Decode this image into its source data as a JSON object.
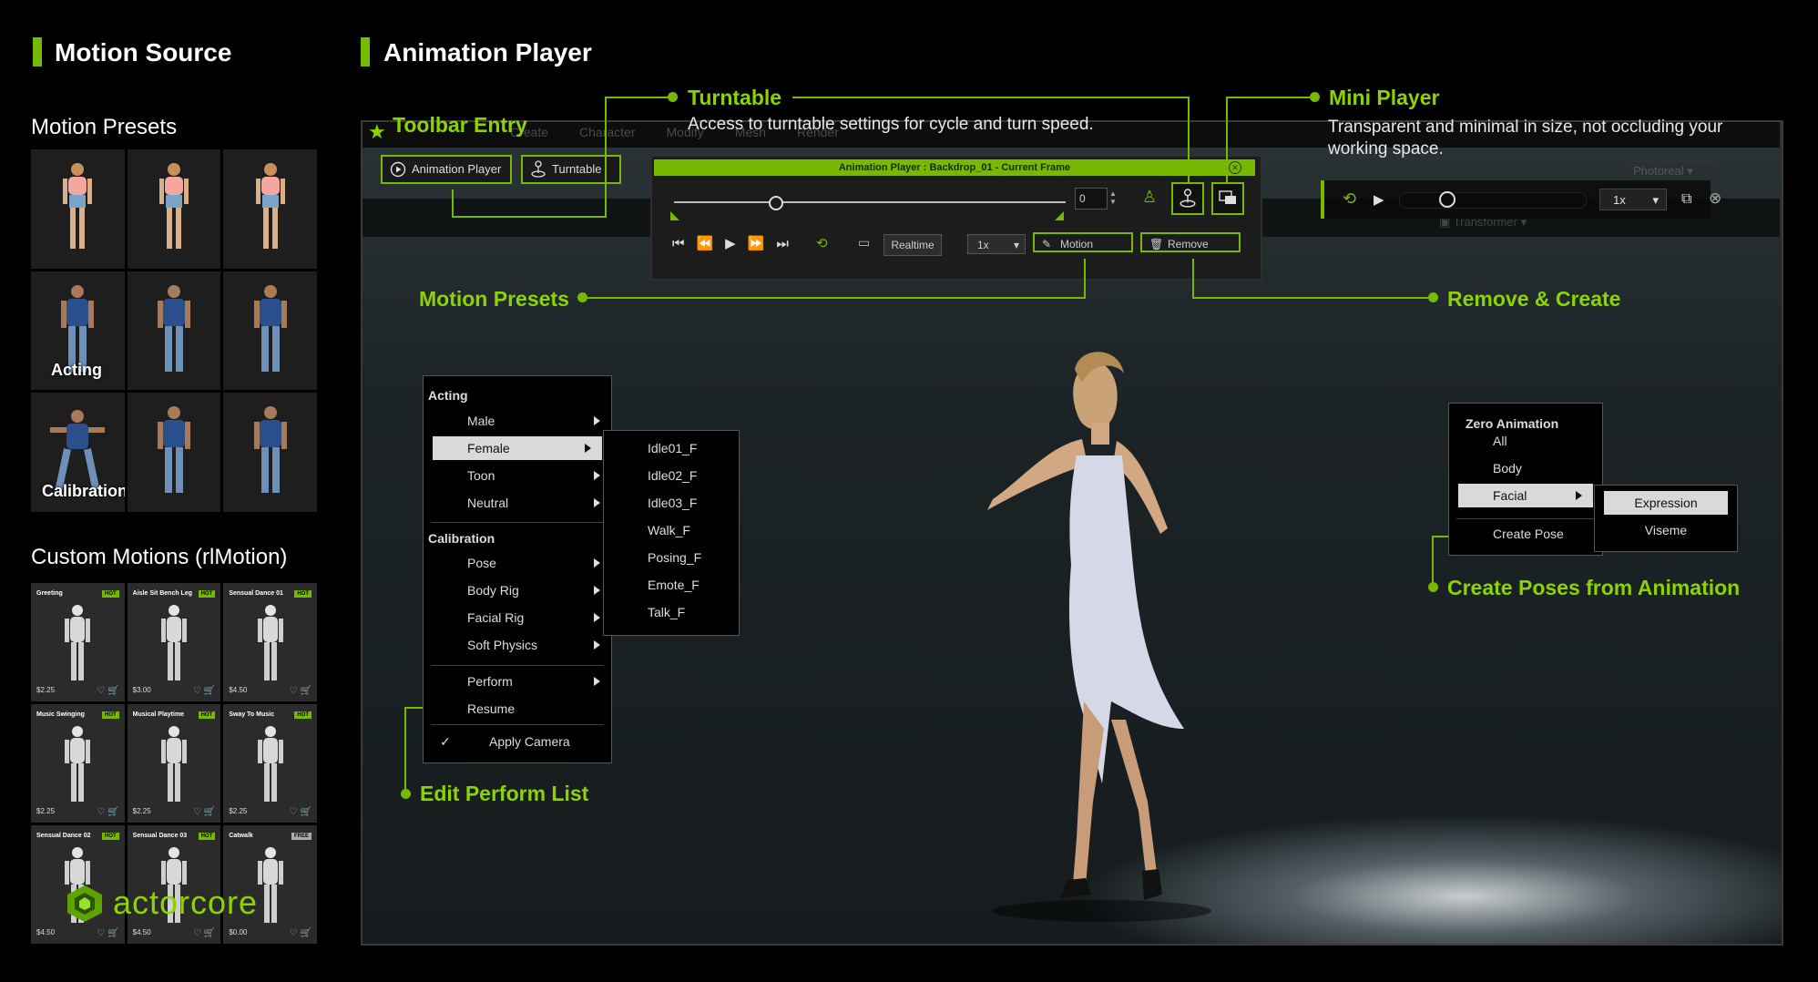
{
  "sections": {
    "motion_source": "Motion Source",
    "animation_player": "Animation Player"
  },
  "left": {
    "motion_presets_title": "Motion Presets",
    "preset_labels": {
      "acting": "Acting",
      "calibration": "Calibration"
    },
    "custom_motions_title": "Custom Motions (rlMotion)",
    "cards": [
      {
        "title": "Greeting",
        "badge": "HOT",
        "price": "$2.25"
      },
      {
        "title": "Aisle Sit Bench Leg",
        "badge": "HOT",
        "price": "$3.00"
      },
      {
        "title": "Sensual Dance 01",
        "badge": "HOT",
        "price": "$4.50"
      },
      {
        "title": "Music Swinging",
        "badge": "HOT",
        "price": "$2.25"
      },
      {
        "title": "Musical Playtime",
        "badge": "HOT",
        "price": "$2.25"
      },
      {
        "title": "Sway To Music",
        "badge": "HOT",
        "price": "$2.25"
      },
      {
        "title": "Sensual Dance 02",
        "badge": "HOT",
        "price": "$4.50"
      },
      {
        "title": "Sensual Dance 03",
        "badge": "HOT",
        "price": "$4.50"
      },
      {
        "title": "Catwalk",
        "badge": "FREE",
        "price": "$0.00"
      }
    ],
    "actorcore_logo": "actorcore"
  },
  "callouts": {
    "toolbar_entry": "Toolbar Entry",
    "turntable": {
      "title": "Turntable",
      "desc": "Access to turntable settings for cycle and turn speed."
    },
    "mini_player": {
      "title": "Mini Player",
      "desc": "Transparent and minimal in size, not occluding your working space."
    },
    "motion_presets": "Motion Presets",
    "remove_create": "Remove & Create",
    "edit_perform": "Edit Perform List",
    "create_poses": "Create Poses from Animation"
  },
  "background_menu": [
    "Create",
    "Character",
    "Modify",
    "Mesh",
    "Render"
  ],
  "toolbar": {
    "animation_player": "Animation Player",
    "turntable": "Turntable"
  },
  "player": {
    "title": "Animation Player : Backdrop_01 - Current Frame",
    "frame": "0",
    "realtime": "Realtime",
    "speed": "1x",
    "motion": "Motion",
    "remove": "Remove"
  },
  "mini_player": {
    "speed": "1x",
    "bg_label_photoreal": "Photoreal",
    "bg_label_transformer": "Transformer"
  },
  "motion_menu": {
    "acting_header": "Acting",
    "acting_items": [
      "Male",
      "Female",
      "Toon",
      "Neutral"
    ],
    "calibration_header": "Calibration",
    "calibration_items": [
      "Pose",
      "Body Rig",
      "Facial Rig",
      "Soft Physics"
    ],
    "perform": "Perform",
    "resume": "Resume",
    "apply_camera": "Apply Camera",
    "check": "✓"
  },
  "female_submenu": [
    "Idle01_F",
    "Idle02_F",
    "Idle03_F",
    "Walk_F",
    "Posing_F",
    "Emote_F",
    "Talk_F"
  ],
  "pose_menu": {
    "header": "Zero Animation",
    "items": [
      "All",
      "Body",
      "Facial"
    ],
    "create_pose": "Create Pose",
    "sub": [
      "Expression",
      "Viseme"
    ]
  },
  "colors": {
    "accent": "#76b900",
    "callout": "#8cd400",
    "viewport": "#1f2628"
  }
}
